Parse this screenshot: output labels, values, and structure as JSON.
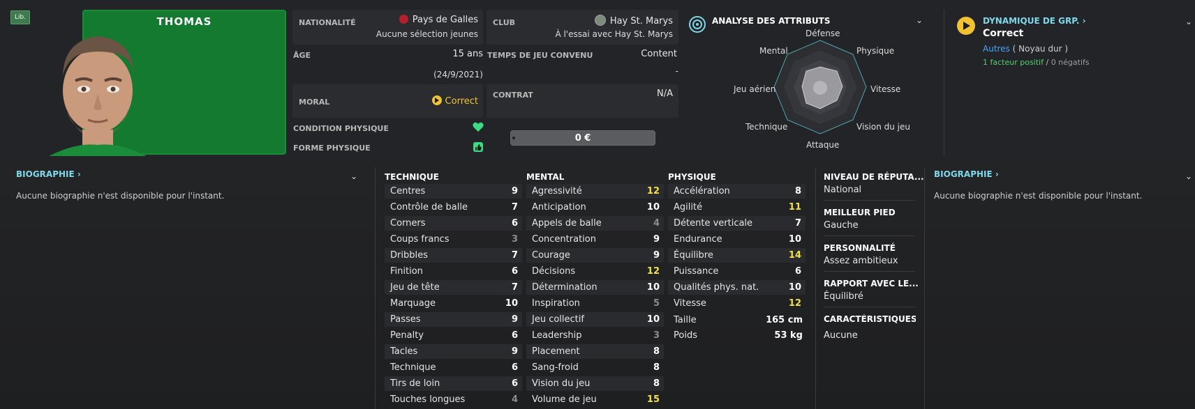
{
  "badge": "Lib.",
  "player": {
    "name": "THOMAS"
  },
  "nationality": {
    "label": "NATIONALITÉ",
    "country": "Pays de Galles",
    "caps": "Aucune sélection jeunes"
  },
  "club": {
    "label": "CLUB",
    "name": "Hay St. Marys",
    "status": "À l'essai avec Hay St. Marys"
  },
  "age": {
    "label": "ÂGE",
    "value": "15 ans",
    "dob": "(24/9/2021)"
  },
  "playing_time": {
    "label": "TEMPS DE JEU CONVENU",
    "value": "Content",
    "extra": "-"
  },
  "morale": {
    "label": "MORAL",
    "value": "Correct"
  },
  "contract": {
    "label": "CONTRAT",
    "value": "N/A"
  },
  "condition": {
    "label": "CONDITION PHYSIQUE"
  },
  "form": {
    "label": "FORME PHYSIQUE"
  },
  "wage": {
    "value": "0 €"
  },
  "analysis": {
    "title": "ANALYSE DES ATTRIBUTS",
    "axes": [
      "Défense",
      "Physique",
      "Vitesse",
      "Vision du jeu",
      "Attaque",
      "Technique",
      "Jeu aérien",
      "Mental"
    ]
  },
  "dynamics": {
    "title": "DYNAMIQUE DE GRP.",
    "value": "Correct",
    "group": "Autres",
    "group_detail": "( Noyau dur )",
    "positive": "1 facteur positif",
    "separator": "/",
    "negative": "0 négatifs"
  },
  "bio_left": {
    "title": "BIOGRAPHIE",
    "text": "Aucune biographie n'est disponible pour l'instant."
  },
  "bio_right": {
    "title": "BIOGRAPHIE",
    "text": "Aucune biographie n'est disponible pour l'instant."
  },
  "technique": {
    "title": "TECHNIQUE",
    "rows": [
      {
        "name": "Centres",
        "value": "9"
      },
      {
        "name": "Contrôle de balle",
        "value": "7"
      },
      {
        "name": "Corners",
        "value": "6"
      },
      {
        "name": "Coups francs",
        "value": "3"
      },
      {
        "name": "Dribbles",
        "value": "7"
      },
      {
        "name": "Finition",
        "value": "6"
      },
      {
        "name": "Jeu de tête",
        "value": "7"
      },
      {
        "name": "Marquage",
        "value": "10"
      },
      {
        "name": "Passes",
        "value": "9"
      },
      {
        "name": "Penalty",
        "value": "6"
      },
      {
        "name": "Tacles",
        "value": "9"
      },
      {
        "name": "Technique",
        "value": "6"
      },
      {
        "name": "Tirs de loin",
        "value": "6"
      },
      {
        "name": "Touches longues",
        "value": "4"
      }
    ]
  },
  "mental": {
    "title": "MENTAL",
    "rows": [
      {
        "name": "Agressivité",
        "value": "12"
      },
      {
        "name": "Anticipation",
        "value": "10"
      },
      {
        "name": "Appels de balle",
        "value": "4"
      },
      {
        "name": "Concentration",
        "value": "9"
      },
      {
        "name": "Courage",
        "value": "9"
      },
      {
        "name": "Décisions",
        "value": "12"
      },
      {
        "name": "Détermination",
        "value": "10"
      },
      {
        "name": "Inspiration",
        "value": "5"
      },
      {
        "name": "Jeu collectif",
        "value": "10"
      },
      {
        "name": "Leadership",
        "value": "3"
      },
      {
        "name": "Placement",
        "value": "8"
      },
      {
        "name": "Sang-froid",
        "value": "8"
      },
      {
        "name": "Vision du jeu",
        "value": "8"
      },
      {
        "name": "Volume de jeu",
        "value": "15"
      }
    ]
  },
  "physique": {
    "title": "PHYSIQUE",
    "rows": [
      {
        "name": "Accélération",
        "value": "8"
      },
      {
        "name": "Agilité",
        "value": "11"
      },
      {
        "name": "Détente verticale",
        "value": "7"
      },
      {
        "name": "Endurance",
        "value": "10"
      },
      {
        "name": "Équilibre",
        "value": "14"
      },
      {
        "name": "Puissance",
        "value": "6"
      },
      {
        "name": "Qualités phys. nat.",
        "value": "10"
      },
      {
        "name": "Vitesse",
        "value": "12"
      }
    ],
    "height": {
      "name": "Taille",
      "value": "165 cm"
    },
    "weight": {
      "name": "Poids",
      "value": "53 kg"
    }
  },
  "info": {
    "reputation": {
      "label": "NIVEAU DE RÉPUTA...",
      "value": "National"
    },
    "foot": {
      "label": "MEILLEUR PIED",
      "value": "Gauche"
    },
    "personality": {
      "label": "PERSONNALITÉ",
      "value": "Assez ambitieux"
    },
    "media": {
      "label": "RAPPORT AVEC LE...",
      "value": "Équilibré"
    },
    "traits": {
      "label": "CARACTÉRISTIQUES J",
      "value": "Aucune"
    }
  },
  "colors": {
    "accent": "#7fd7ea",
    "yellow": "#f4e14a",
    "green": "#3ddc84",
    "pitch": "#137a2f"
  }
}
